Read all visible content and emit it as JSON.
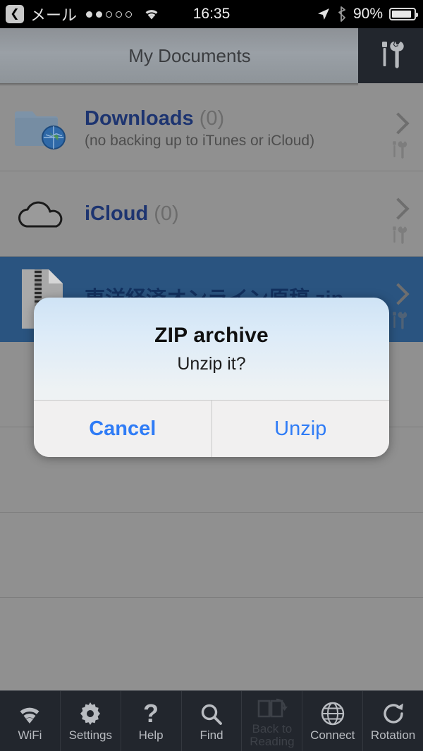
{
  "statusbar": {
    "back_icon": "back-chevron-icon",
    "carrier": "メール",
    "signal_dots_filled": 2,
    "signal_dots_total": 5,
    "wifi_icon": "wifi-icon",
    "time": "16:35",
    "location_icon": "location-arrow-icon",
    "bluetooth_icon": "bluetooth-icon",
    "battery_percent": "90%",
    "battery_level": 90
  },
  "navbar": {
    "title": "My Documents",
    "tools_icon": "tools-icon"
  },
  "list": {
    "rows": [
      {
        "title": "Downloads",
        "count": "(0)",
        "subtitle": "(no backing up to iTunes or iCloud)",
        "icon": "folder-globe-icon",
        "selected": false
      },
      {
        "title": "iCloud",
        "count": "(0)",
        "subtitle": "",
        "icon": "cloud-icon",
        "selected": false
      },
      {
        "title": "東洋経済オンライン原稿.zip",
        "count": "",
        "subtitle": "",
        "icon": "zip-file-icon",
        "selected": true
      }
    ],
    "chevron_icon": "chevron-right-icon",
    "row_tools_icon": "tools-icon"
  },
  "dialog": {
    "title": "ZIP archive",
    "message": "Unzip it?",
    "cancel_label": "Cancel",
    "confirm_label": "Unzip",
    "accent_color": "#2f7cf6"
  },
  "toolbar": {
    "items": [
      {
        "label": "WiFi",
        "icon": "wifi-icon",
        "disabled": false
      },
      {
        "label": "Settings",
        "icon": "gear-icon",
        "disabled": false
      },
      {
        "label": "Help",
        "icon": "question-mark-icon",
        "disabled": false
      },
      {
        "label": "Find",
        "icon": "search-icon",
        "disabled": false
      },
      {
        "label": "Back to Reading",
        "icon": "open-book-icon",
        "disabled": true
      },
      {
        "label": "Connect",
        "icon": "globe-icon",
        "disabled": false
      },
      {
        "label": "Rotation",
        "icon": "rotate-icon",
        "disabled": false
      }
    ]
  },
  "colors": {
    "selection_blue": "#2a5480",
    "list_background": "#909090",
    "toolbar_dark": "#22262d",
    "title_navy": "#1d3470"
  }
}
